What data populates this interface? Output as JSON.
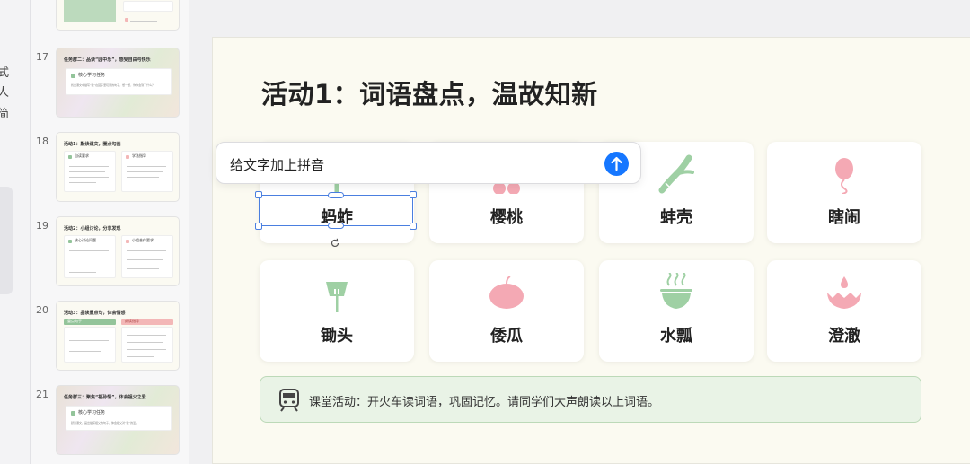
{
  "left_panel": {
    "clipped_chars": [
      "式",
      "人",
      "简"
    ]
  },
  "thumbnails": [
    {
      "number": "17",
      "title": "任务群二：品读“园中乐”，感受自由与快乐",
      "box_label": "核心学习任务",
      "box_text": "找出课文中描写“我”在园子里玩耍的句子，想一想，你体会到了什么？"
    },
    {
      "number": "18",
      "title": "活动1：默读课文，圈点勾画",
      "left_label": "自读要求",
      "right_label": "学法指导"
    },
    {
      "number": "19",
      "title": "活动2：小组讨论，分享发现",
      "left_label": "核心讨论问题",
      "right_label": "小组合作要求"
    },
    {
      "number": "20",
      "title": "活动3：品读重点句，体会情感",
      "left_label": "重点句子",
      "right_label": "朗读指导"
    },
    {
      "number": "21",
      "title": "任务群三：聚焦“祖孙情”，体会祖父之爱",
      "box_label": "核心学习任务",
      "box_text": "默读课文，画出描写祖父的句子，体会祖父对“我”的爱。"
    }
  ],
  "slide": {
    "title": "活动1：词语盘点，温故知新",
    "words": [
      {
        "text": "蚂蚱",
        "icon": "grasshopper-icon"
      },
      {
        "text": "樱桃",
        "icon": "cherry-icon"
      },
      {
        "text": "蚌壳",
        "icon": "leek-icon"
      },
      {
        "text": "瞎闹",
        "icon": "balloon-icon"
      },
      {
        "text": "锄头",
        "icon": "hoe-icon"
      },
      {
        "text": "倭瓜",
        "icon": "pumpkin-icon"
      },
      {
        "text": "水瓢",
        "icon": "bowl-icon"
      },
      {
        "text": "澄澈",
        "icon": "water-drop-icon"
      }
    ],
    "activity_text": "课堂活动：开火车读词语，巩固记忆。请同学们大声朗读以上词语。"
  },
  "prompt": {
    "text": "给文字加上拼音"
  },
  "colors": {
    "accent_blue": "#1677ff",
    "selection_blue": "#4a7fe0",
    "icon_green": "#9fd0a4",
    "icon_pink": "#f4a9b4",
    "activity_bg": "#e9f3e6"
  }
}
